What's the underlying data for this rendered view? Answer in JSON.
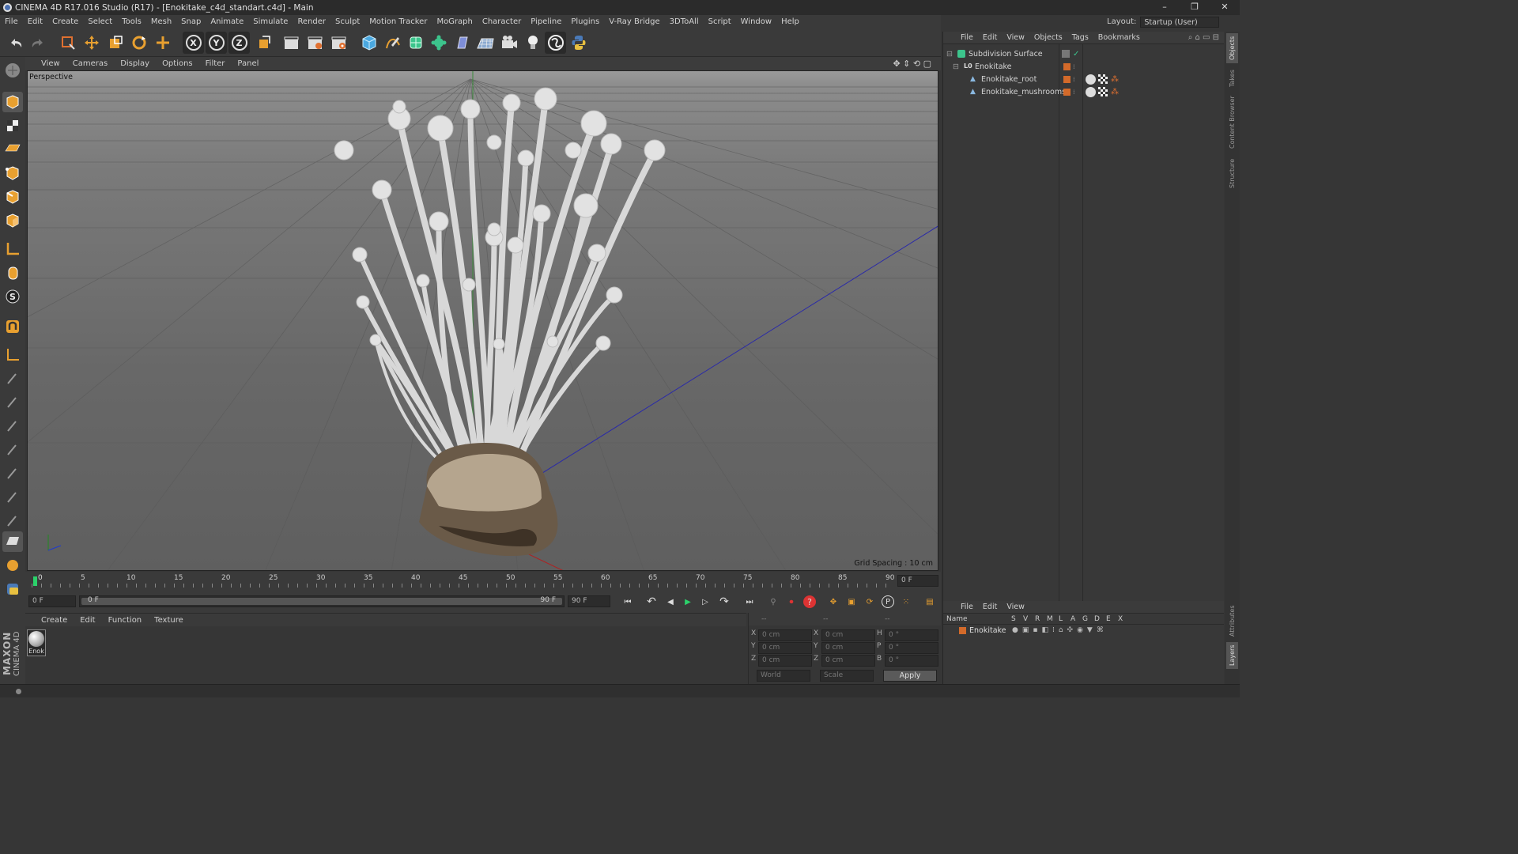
{
  "window": {
    "title": "CINEMA 4D R17.016 Studio (R17) - [Enokitake_c4d_standart.c4d] - Main",
    "min": "–",
    "max": "❐",
    "close": "✕"
  },
  "menu": [
    "File",
    "Edit",
    "Create",
    "Select",
    "Tools",
    "Mesh",
    "Snap",
    "Animate",
    "Simulate",
    "Render",
    "Sculpt",
    "Motion Tracker",
    "MoGraph",
    "Character",
    "Pipeline",
    "Plugins",
    "V-Ray Bridge",
    "3DToAll",
    "Script",
    "Window",
    "Help"
  ],
  "layout": {
    "label": "Layout:",
    "value": "Startup (User)"
  },
  "toolbar": {
    "axis_x": "X",
    "axis_y": "Y",
    "axis_z": "Z"
  },
  "viewport": {
    "menu": [
      "View",
      "Cameras",
      "Display",
      "Options",
      "Filter",
      "Panel"
    ],
    "label": "Perspective",
    "grid_spacing": "Grid Spacing : 10 cm"
  },
  "timeline": {
    "ticks": [
      "0",
      "5",
      "10",
      "15",
      "20",
      "25",
      "30",
      "35",
      "40",
      "45",
      "50",
      "55",
      "60",
      "65",
      "70",
      "75",
      "80",
      "85",
      "90"
    ],
    "current_frame": "0 F"
  },
  "transport": {
    "start": "0 F",
    "range_start": "0 F",
    "range_end": "90 F",
    "end": "90 F"
  },
  "material": {
    "menu": [
      "Create",
      "Edit",
      "Function",
      "Texture"
    ],
    "item": "Enok"
  },
  "coords": {
    "headers": [
      "--",
      "--",
      "--"
    ],
    "rows": [
      {
        "a": "X",
        "av": "0 cm",
        "b": "X",
        "bv": "0 cm",
        "c": "H",
        "cv": "0 °"
      },
      {
        "a": "Y",
        "av": "0 cm",
        "b": "Y",
        "bv": "0 cm",
        "c": "P",
        "cv": "0 °"
      },
      {
        "a": "Z",
        "av": "0 cm",
        "b": "Z",
        "bv": "0 cm",
        "c": "B",
        "cv": "0 °"
      }
    ],
    "world": "World",
    "scale": "Scale",
    "apply": "Apply"
  },
  "objects": {
    "menu": [
      "File",
      "Edit",
      "View",
      "Objects",
      "Tags",
      "Bookmarks"
    ],
    "items": [
      "Subdivision Surface",
      "Enokitake",
      "Enokitake_root",
      "Enokitake_mushrooms"
    ]
  },
  "layers": {
    "menu": [
      "File",
      "Edit",
      "View"
    ],
    "columns": [
      "Name",
      "S",
      "V",
      "R",
      "M",
      "L",
      "A",
      "G",
      "D",
      "E",
      "X"
    ],
    "row": "Enokitake"
  },
  "sidetabs": [
    "Objects",
    "Takes",
    "Content Browser",
    "Structure",
    "Attributes",
    "Layers"
  ],
  "logo": {
    "maxon": "MAXON",
    "c4d": "CINEMA 4D"
  },
  "colors": {
    "accent": "#d36a2a",
    "panel": "#383838",
    "viewport_bg": "#6e6e6e"
  }
}
